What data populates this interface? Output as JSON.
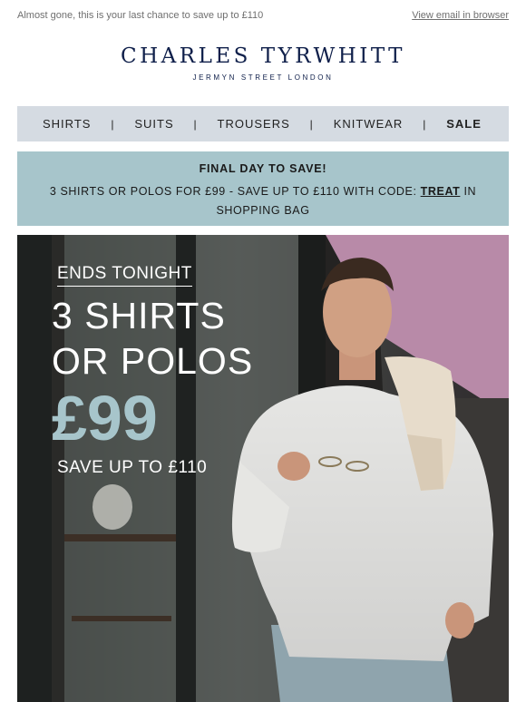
{
  "preheader": {
    "text": "Almost gone, this is your last chance to save up to £110",
    "view_link": "View email in browser"
  },
  "logo": {
    "brand": "CHARLES TYRWHITT",
    "tagline": "JERMYN STREET LONDON"
  },
  "nav": {
    "items": [
      "SHIRTS",
      "SUITS",
      "TROUSERS",
      "KNITWEAR",
      "SALE"
    ],
    "separator": "|"
  },
  "promo": {
    "headline": "FINAL DAY TO SAVE!",
    "body_before": "3 SHIRTS OR POLOS FOR £99 - SAVE UP TO £110 WITH CODE: ",
    "code": "TREAT",
    "body_after": " IN SHOPPING BAG"
  },
  "hero": {
    "ends": "ENDS TONIGHT",
    "line1": "3 SHIRTS",
    "line2": "OR POLOS",
    "price": "£99",
    "save": "SAVE UP TO £110",
    "image_icon": "man-in-white-linen-shirt-photo"
  },
  "colors": {
    "brand_navy": "#0f1f4a",
    "nav_bg": "#d5dbe2",
    "promo_bg": "#a7c5cb",
    "price_accent": "#a7c5cb"
  }
}
